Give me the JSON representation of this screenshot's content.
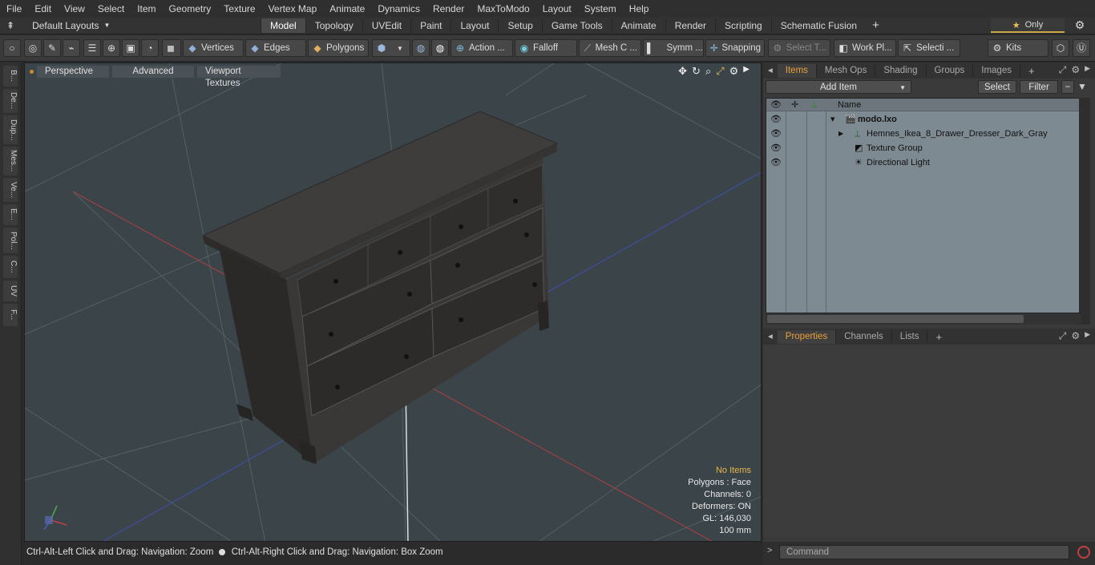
{
  "menu": [
    "File",
    "Edit",
    "View",
    "Select",
    "Item",
    "Geometry",
    "Texture",
    "Vertex Map",
    "Animate",
    "Dynamics",
    "Render",
    "MaxToModo",
    "Layout",
    "System",
    "Help"
  ],
  "layouts": {
    "label": "Default Layouts"
  },
  "tabs": [
    "Model",
    "Topology",
    "UVEdit",
    "Paint",
    "Layout",
    "Setup",
    "Game Tools",
    "Animate",
    "Render",
    "Scripting",
    "Schematic Fusion"
  ],
  "only_label": "Only",
  "toolbar": {
    "vertices": "Vertices",
    "edges": "Edges",
    "polygons": "Polygons",
    "action": "Action ...",
    "falloff": "Falloff",
    "meshc": "Mesh C ...",
    "symm": "Symm ...",
    "snapping": "Snapping",
    "select_t": "Select T...",
    "workpl": "Work Pl...",
    "selecti": "Selecti ...",
    "kits": "Kits"
  },
  "left_tabs": [
    "B...",
    "De...",
    "Dup...",
    "Mes...",
    "Ve...",
    "E...",
    "Pol...",
    "C...",
    "UV",
    "F..."
  ],
  "viewport": {
    "perspective": "Perspective",
    "advanced": "Advanced",
    "textures": "Viewport Textures",
    "info": {
      "no_items": "No Items",
      "polygons": "Polygons : Face",
      "channels": "Channels: 0",
      "deformers": "Deformers: ON",
      "gl": "GL: 146,030",
      "scale": "100 mm"
    }
  },
  "status": {
    "left": "Ctrl-Alt-Left Click and Drag: Navigation: Zoom",
    "right": "Ctrl-Alt-Right Click and Drag: Navigation: Box Zoom"
  },
  "items_panel": {
    "tabs": [
      "Items",
      "Mesh Ops",
      "Shading",
      "Groups",
      "Images"
    ],
    "add_item": "Add Item",
    "select": "Select",
    "filter": "Filter",
    "name_header": "Name",
    "tree": [
      {
        "name": "modo.lxo"
      },
      {
        "name": "Hemnes_Ikea_8_Drawer_Dresser_Dark_Gray"
      },
      {
        "name": "Texture Group"
      },
      {
        "name": "Directional Light"
      }
    ]
  },
  "props_panel": {
    "tabs": [
      "Properties",
      "Channels",
      "Lists"
    ]
  },
  "command": {
    "placeholder": "Command"
  },
  "colors": {
    "accent": "#e8a03a",
    "viewport_bg": "#3a4449",
    "tree_bg": "#7e8a92"
  }
}
